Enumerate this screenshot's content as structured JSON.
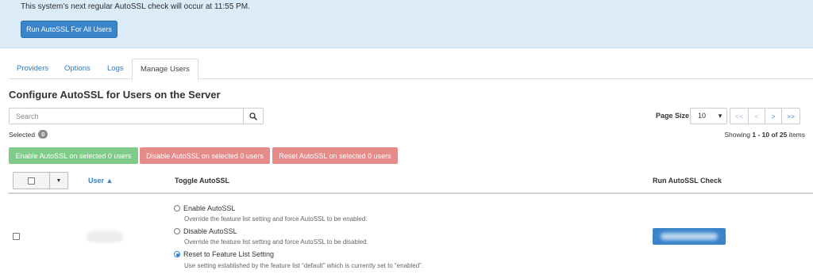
{
  "banner": {
    "message": "This system’s next regular AutoSSL check will occur at 11:55 PM.",
    "run_all_label": "Run AutoSSL For All Users"
  },
  "tabs": [
    {
      "label": "Providers",
      "active": false
    },
    {
      "label": "Options",
      "active": false
    },
    {
      "label": "Logs",
      "active": false
    },
    {
      "label": "Manage Users",
      "active": true
    }
  ],
  "page_title": "Configure AutoSSL for Users on the Server",
  "search": {
    "placeholder": "Search",
    "value": ""
  },
  "selection": {
    "label": "Selected",
    "count": "0"
  },
  "paging": {
    "page_size_label": "Page Size",
    "page_size": "10",
    "first": "<<",
    "prev": "<",
    "next": ">",
    "last": ">>",
    "showing_prefix": "Showing",
    "showing_range": "1 - 10 of 25",
    "showing_suffix": "items"
  },
  "bulk_actions": {
    "enable": "Enable AutoSSL on selected 0 users",
    "disable": "Disable AutoSSL on selected 0 users",
    "reset": "Reset AutoSSL on selected 0 users",
    "enable_color": "#7fcb88",
    "disable_color": "#e58b89"
  },
  "table": {
    "headers": {
      "user": "User ▲",
      "toggle": "Toggle AutoSSL",
      "run": "Run AutoSSL Check"
    },
    "rows": [
      {
        "options": [
          {
            "label": "Enable AutoSSL",
            "desc": "Override the feature list setting and force AutoSSL to be enabled.",
            "checked": false
          },
          {
            "label": "Disable AutoSSL",
            "desc": "Override the feature list setting and force AutoSSL to be disabled.",
            "checked": false
          },
          {
            "label": "Reset to Feature List Setting",
            "desc": "Use setting established by the feature list “default” which is currently set to “enabled”.",
            "checked": true
          }
        ]
      }
    ]
  },
  "accent_color": "#3a84c9"
}
